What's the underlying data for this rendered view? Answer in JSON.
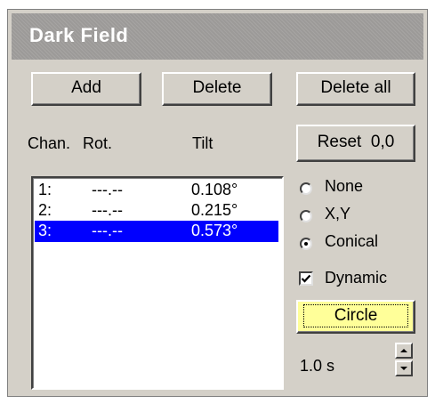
{
  "panel": {
    "title": "Dark Field"
  },
  "buttons": {
    "add": "Add",
    "delete": "Delete",
    "delete_all": "Delete all",
    "reset": "Reset  0,0",
    "circle": "Circle"
  },
  "columns": {
    "chan": "Chan.",
    "rot": "Rot.",
    "tilt": "Tilt"
  },
  "rows": [
    {
      "chan": "1:",
      "rot": "---.--",
      "tilt": "0.108°",
      "selected": false
    },
    {
      "chan": "2:",
      "rot": "---.--",
      "tilt": "0.215°",
      "selected": false
    },
    {
      "chan": "3:",
      "rot": "---.--",
      "tilt": "0.573°",
      "selected": true
    }
  ],
  "mode_options": [
    {
      "label": "None",
      "selected": false
    },
    {
      "label": "X,Y",
      "selected": false
    },
    {
      "label": "Conical",
      "selected": true
    }
  ],
  "dynamic": {
    "label": "Dynamic",
    "checked": true
  },
  "timing": {
    "value": "1.0 s"
  },
  "colors": {
    "selection": "#0000ff",
    "circle_button": "#ffff99"
  },
  "icons": {
    "spin_up": "spin-up-arrow-icon",
    "spin_down": "spin-down-arrow-icon",
    "check": "checkmark-icon"
  }
}
